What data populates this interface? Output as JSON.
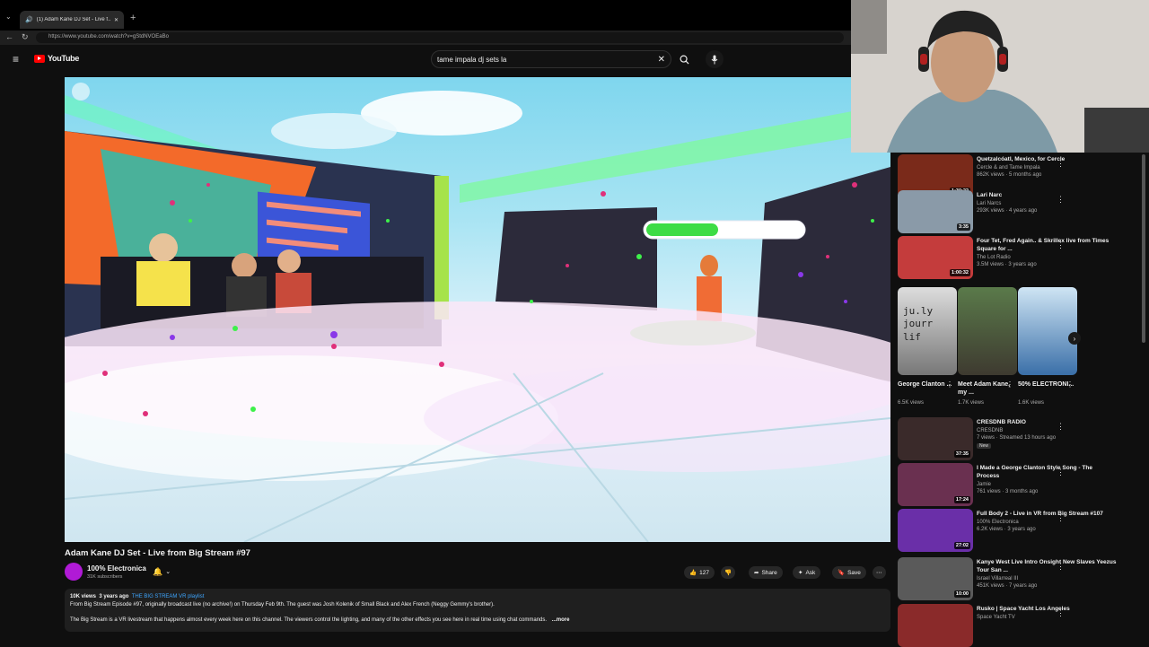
{
  "browser": {
    "tab_title": "(1) Adam Kane DJ Set - Live f...",
    "url": "https://www.youtube.com/watch?v=gStdNVOEaBo"
  },
  "header": {
    "logo_text": "YouTube",
    "search_value": "tame impala dj sets la"
  },
  "video": {
    "title": "Adam Kane DJ Set - Live from Big Stream #97"
  },
  "channel": {
    "name": "100% Electronica",
    "subscribers": "31K subscribers"
  },
  "actions": {
    "likes": "127",
    "share": "Share",
    "ask": "Ask",
    "save": "Save"
  },
  "description": {
    "views": "10K views",
    "age": "3 years ago",
    "playlist": "THE BIG STREAM VR playlist",
    "line1": "From Big Stream Episode #97, originally broadcast live (no archive!) on Thursday Feb 9th. The guest was Josh Kolenik of Small Black and Alex French (Neggy Gemmy's brother).",
    "line2": "The Big Stream is a VR livestream that happens almost every week here on this channel. The viewers control the lighting, and many of the other effects you see here in real time using chat commands.",
    "more": "...more"
  },
  "recommendations": [
    {
      "title": "Quetzalcóatl, Mexico, for Cercle",
      "channel": "Cercle & and Tame Impala",
      "stats": "862K views · 5 months ago",
      "duration": "1:30:22"
    },
    {
      "title": "Lari Narc",
      "channel": "Lari Narcs",
      "stats": "293K views · 4 years ago",
      "duration": "3:35"
    },
    {
      "title": "Four Tet, Fred Again.. & Skrillex live from Times Square for ...",
      "channel": "The Lot Radio",
      "stats": "3.5M views · 3 years ago",
      "duration": "1:00:32"
    },
    {
      "title": "CRESDNB RADIO",
      "channel": "CRESDNB",
      "stats": "7 views · Streamed 13 hours ago",
      "badge": "New",
      "duration": "37:35"
    },
    {
      "title": "I Made a George Clanton Style Song - The Process",
      "channel": "Jamie",
      "stats": "761 views · 3 months ago",
      "duration": "17:24"
    },
    {
      "title": "Full Body 2 - Live in VR from Big Stream #107",
      "channel": "100% Electronica",
      "stats": "6.2K views · 3 years ago",
      "duration": "27:02"
    },
    {
      "title": "Kanye West Live Intro Onsight New Slaves Yeezus Tour San ...",
      "channel": "Israel Villarreal III",
      "stats": "451K views · 7 years ago",
      "duration": "10:00"
    },
    {
      "title": "Rusko | Space Yacht Los Angeles",
      "channel": "Space Yacht TV",
      "stats": "",
      "duration": ""
    }
  ],
  "shorts": [
    {
      "title": "George Clanton ...",
      "views": "6.5K views"
    },
    {
      "title": "Meet Adam Kane, my ...",
      "views": "1.7K views"
    },
    {
      "title": "50% ELECTRONI...",
      "views": "1.6K views"
    }
  ]
}
